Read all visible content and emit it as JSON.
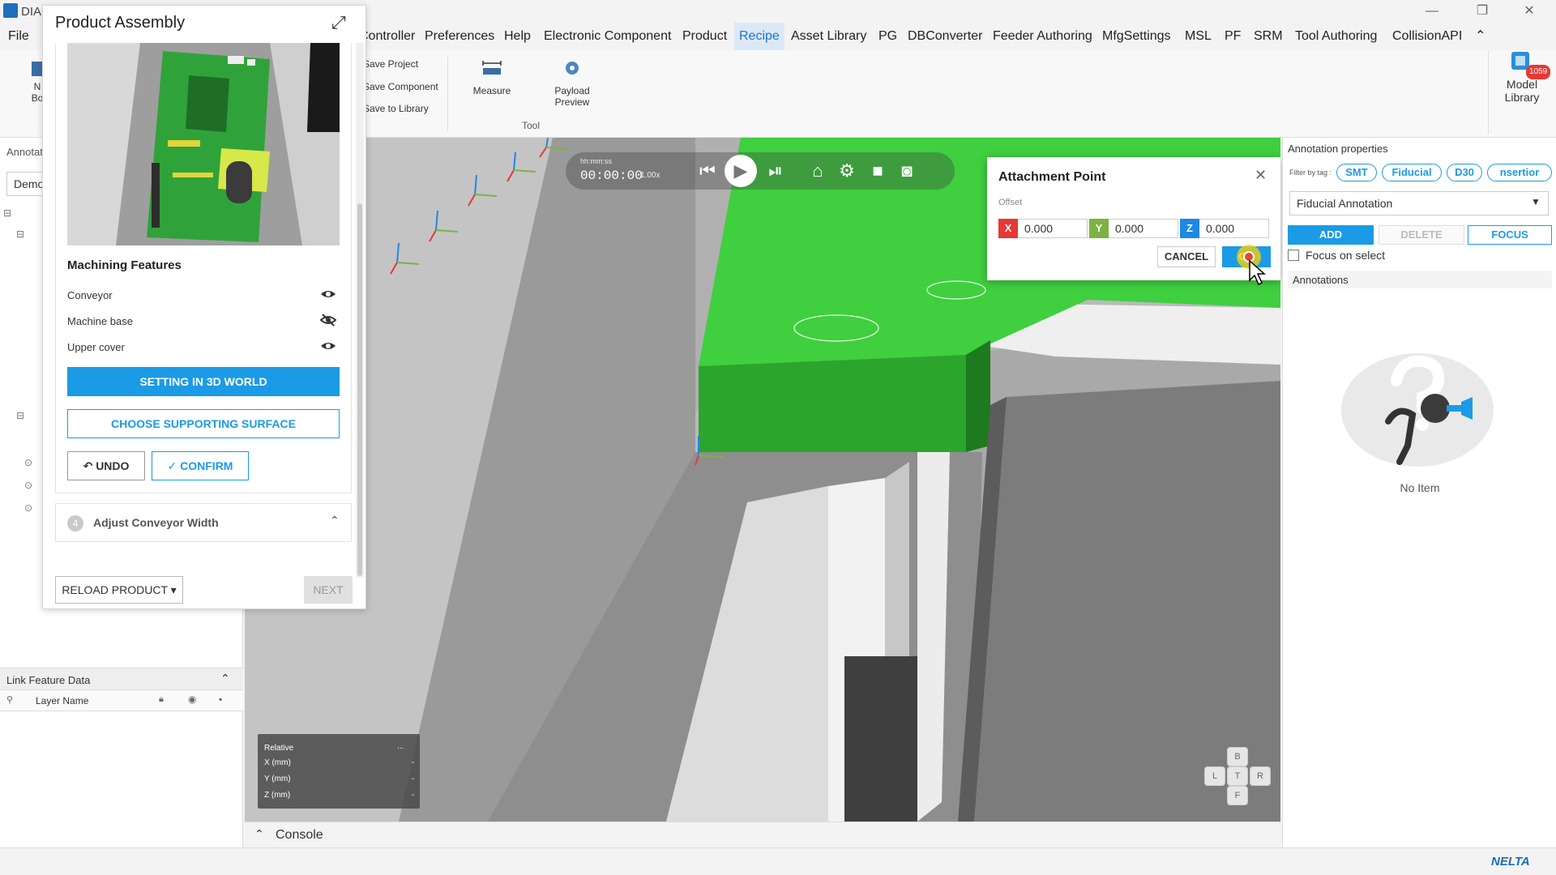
{
  "app": {
    "name": "DIA"
  },
  "window_controls": {
    "minimize": "—",
    "restore": "❐",
    "close": "✕"
  },
  "menu": {
    "items": [
      {
        "label": "File"
      },
      {
        "label": "Controller"
      },
      {
        "label": "Preferences"
      },
      {
        "label": "Help"
      },
      {
        "label": "Electronic Component"
      },
      {
        "label": "Product"
      },
      {
        "label": "Recipe"
      },
      {
        "label": "Asset Library"
      },
      {
        "label": "PG"
      },
      {
        "label": "DBConverter"
      },
      {
        "label": "Feeder Authoring"
      },
      {
        "label": "MfgSettings"
      },
      {
        "label": "MSL"
      },
      {
        "label": "PF"
      },
      {
        "label": "SRM"
      },
      {
        "label": "Tool Authoring"
      },
      {
        "label": "CollisionAPI"
      }
    ],
    "collapse_icon": "⌃",
    "active": "Recipe"
  },
  "ribbon": {
    "small_items": [
      "Save Project",
      "Save Component",
      "Save to Library"
    ],
    "partial_left_label": "N\nBo",
    "measure": "Measure",
    "payload_preview": "Payload\nPreview",
    "group_label": "Tool",
    "model_library": "Model\nLibrary",
    "model_library_badge": "1059"
  },
  "left_panel": {
    "annotation_label": "Annotat",
    "select_value": "Demo",
    "link_feature_title": "Link Feature Data",
    "layer_name_header": "Layer Name"
  },
  "product_assembly": {
    "title": "Product Assembly",
    "machining_features_title": "Machining Features",
    "features": [
      {
        "label": "Conveyor",
        "visible": true
      },
      {
        "label": "Machine base",
        "visible": false
      },
      {
        "label": "Upper cover",
        "visible": true
      }
    ],
    "setting_3d_label": "SETTING IN 3D WORLD",
    "choose_surface_label": "CHOOSE SUPPORTING SURFACE",
    "undo_label": "UNDO",
    "confirm_label": "CONFIRM",
    "step4_number": "4",
    "step4_label": "Adjust  Conveyor Width",
    "reload_label": "RELOAD PRODUCT",
    "next_label": "NEXT"
  },
  "player": {
    "time_format_label": "hh:mm:ss",
    "time": "00:00:00",
    "speed": "1.00x"
  },
  "relative_box": {
    "title": "Relative",
    "menu": "...",
    "rows": [
      {
        "label": "X (mm)",
        "value": "-"
      },
      {
        "label": "Y (mm)",
        "value": "-"
      },
      {
        "label": "Z (mm)",
        "value": "-"
      }
    ]
  },
  "navcube": {
    "top": "B",
    "left": "L",
    "center": "T",
    "right": "R",
    "bottom": "F"
  },
  "attachment_dialog": {
    "title": "Attachment Point",
    "offset_label": "Offset",
    "x_label": "X",
    "x_value": "0.000",
    "y_label": "Y",
    "y_value": "0.000",
    "z_label": "Z",
    "z_value": "0.000",
    "cancel_label": "CANCEL",
    "ok_label": "OK"
  },
  "annotation_properties": {
    "title": "Annotation properties",
    "filter_label": "Filter by tag :",
    "tags": [
      "SMT",
      "Fiducial",
      "D30",
      "nsertior"
    ],
    "select_value": "Fiducial Annotation",
    "add_label": "ADD",
    "delete_label": "DELETE",
    "focus_label": "FOCUS",
    "focus_on_select_label": "Focus on select",
    "annotations_label": "Annotations",
    "empty_label": "No Item"
  },
  "console": {
    "label": "Console"
  },
  "brand": {
    "label": "NELTA"
  },
  "colors": {
    "accent": "#1b9be6",
    "x_axis": "#e53935",
    "y_axis": "#7cb342",
    "z_axis": "#1e88e5",
    "pcb_green": "#3fcf3f"
  }
}
